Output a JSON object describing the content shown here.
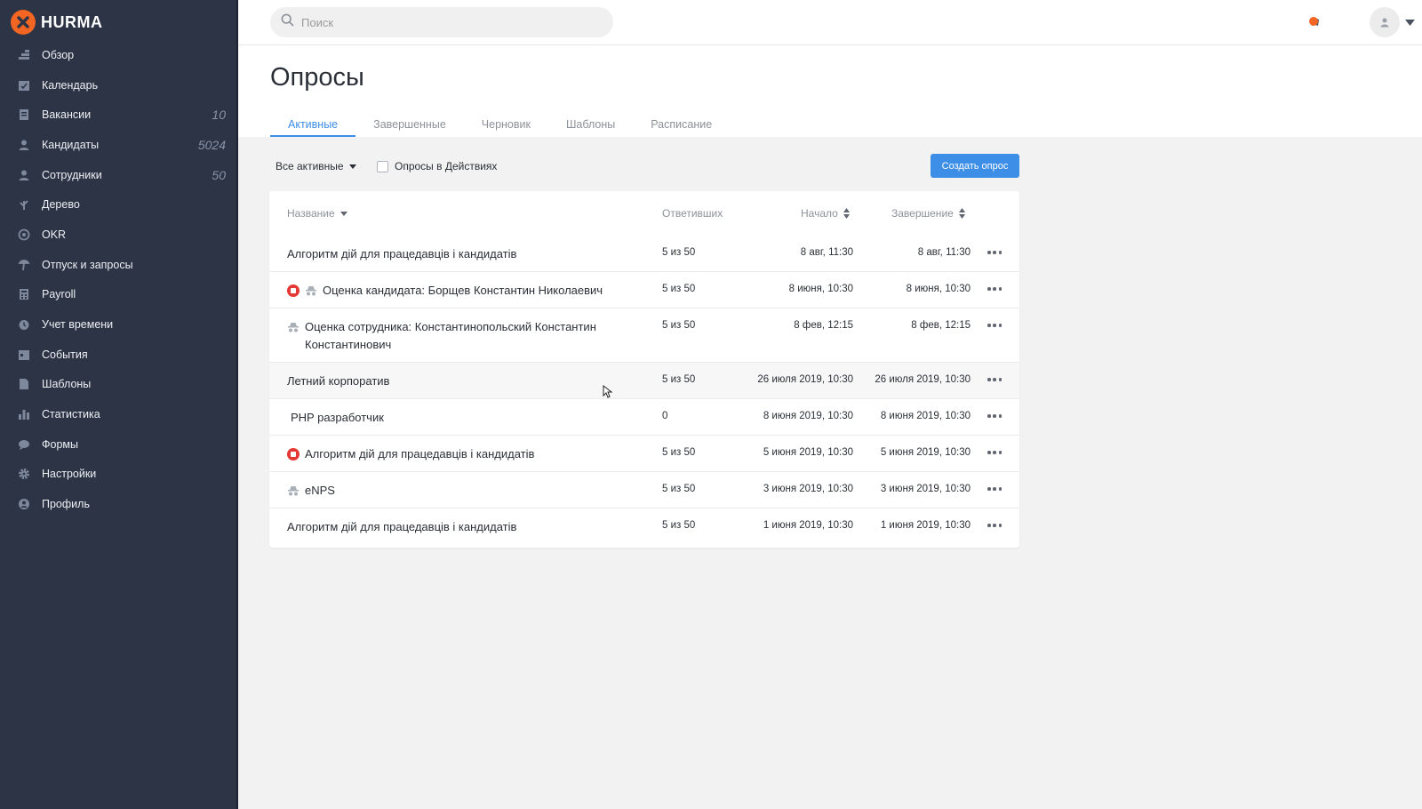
{
  "app": {
    "name": "HURMA",
    "accent": "#f26522",
    "primary": "#3d8ee6"
  },
  "sidebar": {
    "items": [
      {
        "label": "Обзор",
        "icon": "overview-icon"
      },
      {
        "label": "Календарь",
        "icon": "calendar-icon"
      },
      {
        "label": "Вакансии",
        "icon": "vacancies-icon",
        "count": "10"
      },
      {
        "label": "Кандидаты",
        "icon": "candidates-icon",
        "count": "5024"
      },
      {
        "label": "Сотрудники",
        "icon": "employees-icon",
        "count": "50"
      },
      {
        "label": "Дерево",
        "icon": "tree-icon"
      },
      {
        "label": "OKR",
        "icon": "target-icon"
      },
      {
        "label": "Отпуск и запросы",
        "icon": "vacation-icon"
      },
      {
        "label": "Payroll",
        "icon": "calculator-icon"
      },
      {
        "label": "Учет времени",
        "icon": "clock-icon"
      },
      {
        "label": "События",
        "icon": "events-icon"
      },
      {
        "label": "Шаблоны",
        "icon": "templates-icon"
      },
      {
        "label": "Статистика",
        "icon": "stats-icon"
      },
      {
        "label": "Формы",
        "icon": "forms-icon"
      },
      {
        "label": "Настройки",
        "icon": "gear-icon"
      },
      {
        "label": "Профиль",
        "icon": "profile-icon"
      }
    ]
  },
  "topbar": {
    "search_placeholder": "Поиск"
  },
  "page": {
    "title": "Опросы",
    "tabs": [
      {
        "label": "Активные",
        "active": true
      },
      {
        "label": "Завершенные"
      },
      {
        "label": "Черновик"
      },
      {
        "label": "Шаблоны"
      },
      {
        "label": "Расписание"
      }
    ]
  },
  "toolbar": {
    "filter_label": "Все активные",
    "checkbox_label": "Опросы в Действиях",
    "create_label": "Создать опрос"
  },
  "table": {
    "columns": {
      "name": "Название",
      "responded": "Ответивших",
      "start": "Начало",
      "end": "Завершение"
    },
    "rows": [
      {
        "name": "Алгоритм дій для працедавців і кандидатів",
        "responded": "5 из 50",
        "start": "8 авг, 11:30",
        "end": "8 авг, 11:30",
        "icons": []
      },
      {
        "name": "Оценка кандидата: Борщев Константин Николаевич",
        "responded": "5 из 50",
        "start": "8 июня, 10:30",
        "end": "8 июня, 10:30",
        "icons": [
          "stop-icon",
          "incognito-icon"
        ]
      },
      {
        "name": "Оценка сотрудника: Константинопольский Константин Константинович",
        "responded": "5 из 50",
        "start": "8 фев, 12:15",
        "end": "8 фев, 12:15",
        "icons": [
          "incognito-icon"
        ]
      },
      {
        "name": "Летний корпоратив",
        "responded": "5 из 50",
        "start": "26 июля 2019, 10:30",
        "end": "26 июля 2019, 10:30",
        "icons": [],
        "hover": true
      },
      {
        "name": "PHP разработчик",
        "responded": "0",
        "start": "8 июня 2019, 10:30",
        "end": "8 июня 2019, 10:30",
        "icons": []
      },
      {
        "name": "Алгоритм дій для працедавців і кандидатів",
        "responded": "5 из 50",
        "start": "5 июня 2019, 10:30",
        "end": "5 июня 2019, 10:30",
        "icons": [
          "stop-icon"
        ]
      },
      {
        "name": "eNPS",
        "responded": "5 из 50",
        "start": "3 июня 2019, 10:30",
        "end": "3 июня 2019, 10:30",
        "icons": [
          "incognito-icon"
        ]
      },
      {
        "name": "Алгоритм дій для працедавців і кандидатів",
        "responded": "5 из 50",
        "start": "1 июня 2019, 10:30",
        "end": "1 июня 2019, 10:30",
        "icons": []
      }
    ]
  }
}
